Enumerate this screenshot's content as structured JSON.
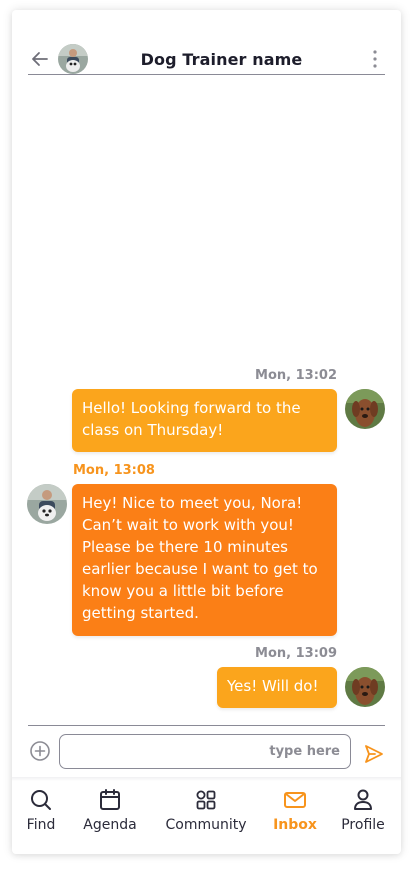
{
  "header": {
    "title": "Dog Trainer name",
    "back_icon": "arrow-left-icon",
    "more_icon": "more-vertical-icon"
  },
  "colors": {
    "accent": "#f7941d",
    "bubble_outgoing": "#fba51c",
    "bubble_incoming": "#fb7f16",
    "muted": "#8c8c94"
  },
  "messages": [
    {
      "time": "Mon, 13:02",
      "sender": "user",
      "text": "Hello! Looking forward to the class on Thursday!"
    },
    {
      "time": "Mon, 13:08",
      "sender": "trainer",
      "text": "Hey! Nice to meet you, Nora! Can’t wait to work with you! Please be there 10 minutes earlier because I want to get to know you a little bit before getting started."
    },
    {
      "time": "Mon, 13:09",
      "sender": "user",
      "text": "Yes! Will do!"
    }
  ],
  "composer": {
    "placeholder": "type here",
    "value": "",
    "add_icon": "plus-circle-icon",
    "send_icon": "send-icon"
  },
  "nav": {
    "active": "Inbox",
    "items": [
      {
        "label": "Find",
        "icon": "search-icon"
      },
      {
        "label": "Agenda",
        "icon": "calendar-icon"
      },
      {
        "label": "Community",
        "icon": "grid-icon"
      },
      {
        "label": "Inbox",
        "icon": "mail-icon"
      },
      {
        "label": "Profile",
        "icon": "user-icon"
      }
    ]
  }
}
